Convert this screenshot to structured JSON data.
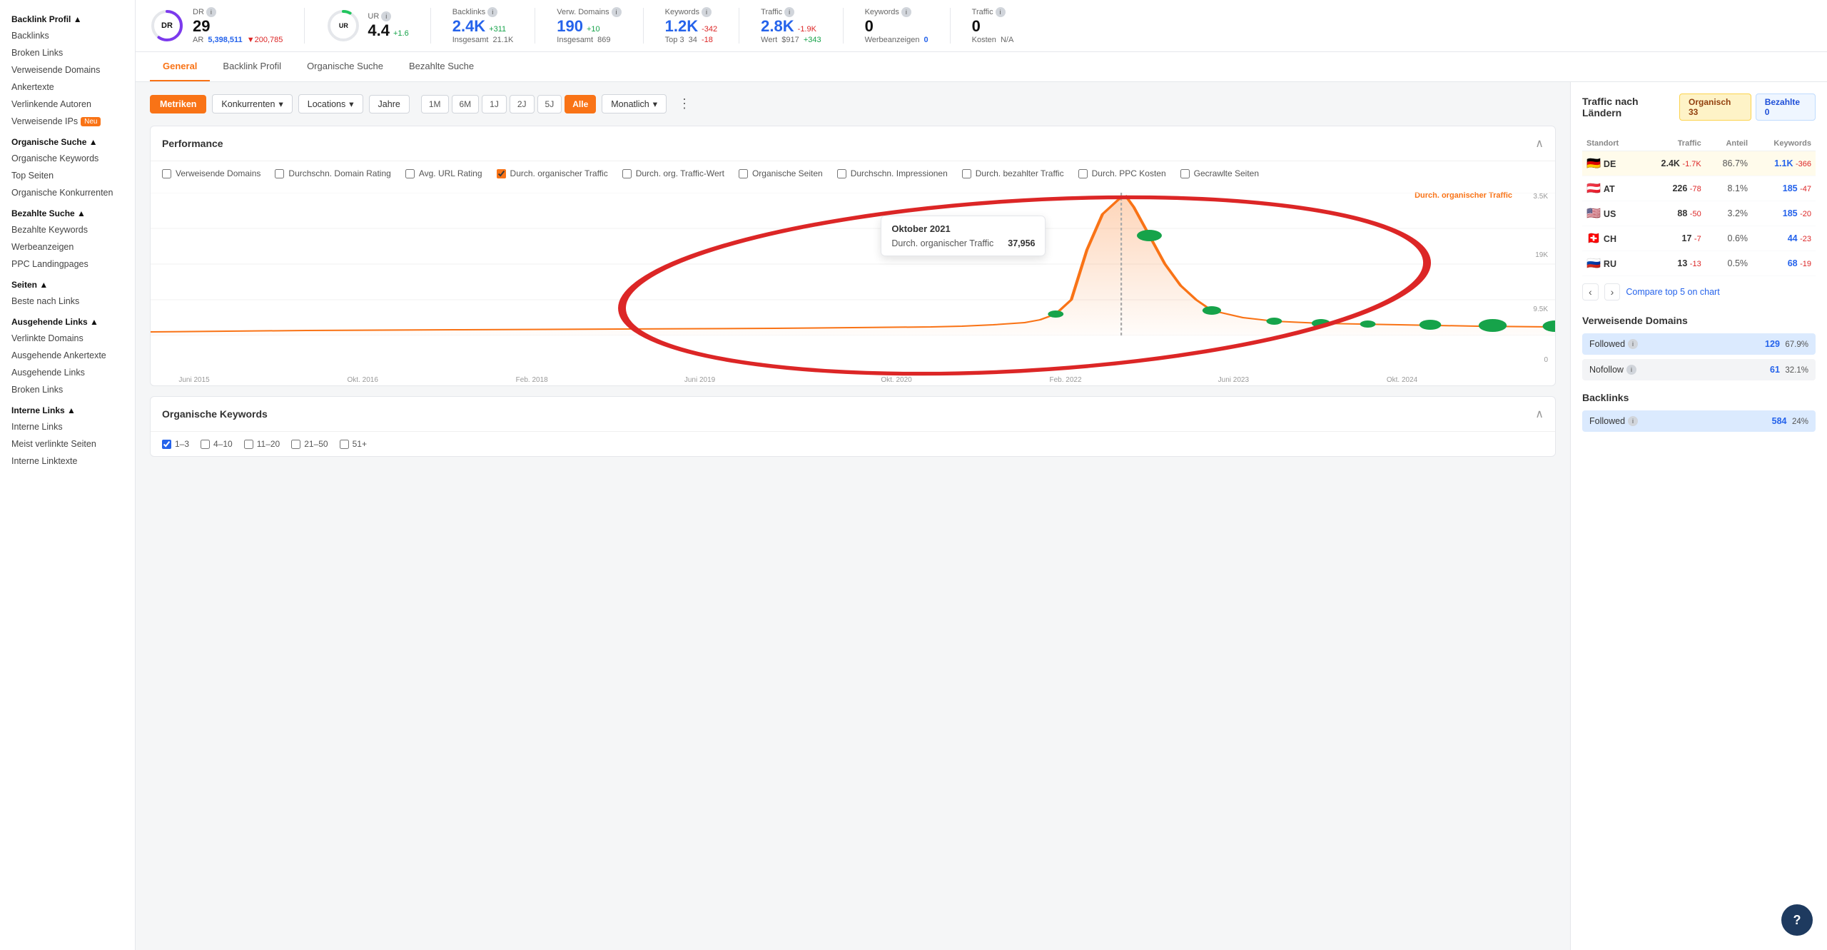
{
  "sidebar": {
    "title": "Backlink Profil",
    "sections": [
      {
        "title": "Backlink Profil ▲",
        "items": [
          "Backlinks",
          "Broken Links",
          "Verweisende Domains",
          "Ankertexte",
          "Verlinkende Autoren",
          "Verweisende IPs"
        ]
      },
      {
        "title": "Organische Suche ▲",
        "items": [
          "Organische Keywords",
          "Top Seiten",
          "Organische Konkurrenten"
        ]
      },
      {
        "title": "Bezahlte Suche ▲",
        "items": [
          "Bezahlte Keywords",
          "Werbeanzeigen",
          "PPC Landingpages"
        ]
      },
      {
        "title": "Seiten ▲",
        "items": [
          "Beste nach Links"
        ]
      },
      {
        "title": "Ausgehende Links ▲",
        "items": [
          "Verlinkte Domains",
          "Ausgehende Ankertexte",
          "Ausgehende Links",
          "Broken Links"
        ]
      },
      {
        "title": "Interne Links ▲",
        "items": [
          "Interne Links",
          "Meist verlinkte Seiten",
          "Interne Linktexte"
        ]
      }
    ],
    "badge_new": "Neu"
  },
  "metrics": {
    "dr": {
      "label": "DR",
      "value": "29",
      "ar_label": "AR",
      "ar_value": "5,398,511",
      "ar_change": "▼200,785",
      "ar_change_color": "neg"
    },
    "ur": {
      "label": "UR",
      "value": "4.4",
      "change": "+1.6",
      "change_color": "pos"
    },
    "backlinks": {
      "label": "Backlinks",
      "value": "2.4K",
      "change": "+311",
      "change_color": "pos",
      "sub_label": "Insgesamt",
      "sub_value": "21.1K"
    },
    "verw_domains": {
      "label": "Verw. Domains",
      "value": "190",
      "change": "+10",
      "change_color": "pos",
      "sub_label": "Insgesamt",
      "sub_value": "869"
    },
    "keywords": {
      "label": "Keywords",
      "value": "1.2K",
      "change": "-342",
      "change_color": "neg",
      "sub_label": "Top 3",
      "sub_value": "34",
      "sub_change": "-18",
      "sub_change_color": "neg"
    },
    "traffic": {
      "label": "Traffic",
      "value": "2.8K",
      "change": "-1.9K",
      "change_color": "neg",
      "sub_label": "Wert",
      "sub_value": "$917",
      "sub_change": "+343",
      "sub_change_color": "pos"
    },
    "keywords2": {
      "label": "Keywords",
      "value": "0",
      "sub_label": "Werbeanzeigen",
      "sub_value": "0"
    },
    "traffic2": {
      "label": "Traffic",
      "value": "0",
      "sub_label": "Kosten",
      "sub_value": "N/A"
    }
  },
  "tabs": [
    "General",
    "Backlink Profil",
    "Organische Suche",
    "Bezahlte Suche"
  ],
  "active_tab": "General",
  "toolbar": {
    "metriken_label": "Metriken",
    "konkurrenten_label": "Konkurrenten",
    "locations_label": "Locations",
    "jahre_label": "Jahre",
    "time_buttons": [
      "1M",
      "6M",
      "1J",
      "2J",
      "5J",
      "Alle"
    ],
    "active_time": "Alle",
    "monatlich_label": "Monatlich"
  },
  "performance": {
    "title": "Performance",
    "checkboxes": [
      {
        "label": "Verweisende Domains",
        "checked": false
      },
      {
        "label": "Durchschn. Domain Rating",
        "checked": false
      },
      {
        "label": "Avg. URL Rating",
        "checked": false
      },
      {
        "label": "Durch. organischer Traffic",
        "checked": true
      },
      {
        "label": "Durch. org. Traffic-Wert",
        "checked": false
      },
      {
        "label": "Organische Seiten",
        "checked": false
      },
      {
        "label": "Durchschn. Impressionen",
        "checked": false
      },
      {
        "label": "Durch. bezahlter Traffic",
        "checked": false
      },
      {
        "label": "Durch. PPC Kosten",
        "checked": false
      },
      {
        "label": "Gecrawlte Seiten",
        "checked": false
      }
    ],
    "chart_line_label": "Durch. organischer Traffic",
    "tooltip": {
      "date": "Oktober 2021",
      "label": "Durch. organischer Traffic",
      "value": "37,956"
    },
    "y_axis": [
      "3.5K",
      "19K",
      "9.5K",
      "0"
    ],
    "x_axis": [
      "Juni 2015",
      "Okt. 2016",
      "Feb. 2018",
      "Juni 2019",
      "Okt. 2020",
      "Feb. 2022",
      "Juni 2023",
      "Okt. 2024"
    ]
  },
  "organic_keywords": {
    "title": "Organische Keywords",
    "checkboxes": [
      {
        "label": "1–3",
        "checked": true
      },
      {
        "label": "4–10",
        "checked": false
      },
      {
        "label": "11–20",
        "checked": false
      },
      {
        "label": "21–50",
        "checked": false
      },
      {
        "label": "51+",
        "checked": false
      }
    ]
  },
  "right_panel": {
    "traffic_title": "Traffic nach Ländern",
    "organic_tab": "Organisch 33",
    "bezahlte_tab": "Bezahlte 0",
    "table": {
      "headers": [
        "Standort",
        "Traffic",
        "Anteil",
        "Keywords"
      ],
      "rows": [
        {
          "flag": "🇩🇪",
          "code": "DE",
          "traffic": "2.4K",
          "change": "-1.7K",
          "change_color": "neg",
          "pct": "86.7%",
          "kw": "1.1K",
          "kw_change": "-366",
          "kw_color": "neg",
          "highlighted": true
        },
        {
          "flag": "🇦🇹",
          "code": "AT",
          "traffic": "226",
          "change": "-78",
          "change_color": "neg",
          "pct": "8.1%",
          "kw": "185",
          "kw_change": "-47",
          "kw_color": "neg",
          "highlighted": false
        },
        {
          "flag": "🇺🇸",
          "code": "US",
          "traffic": "88",
          "change": "-50",
          "change_color": "neg",
          "pct": "3.2%",
          "kw": "185",
          "kw_change": "-20",
          "kw_color": "neg",
          "highlighted": false
        },
        {
          "flag": "🇨🇭",
          "code": "CH",
          "traffic": "17",
          "change": "-7",
          "change_color": "neg",
          "pct": "0.6%",
          "kw": "44",
          "kw_change": "-23",
          "kw_color": "neg",
          "highlighted": false
        },
        {
          "flag": "🇷🇺",
          "code": "RU",
          "traffic": "13",
          "change": "-13",
          "change_color": "neg",
          "pct": "0.5%",
          "kw": "68",
          "kw_change": "-19",
          "kw_color": "neg",
          "highlighted": false
        }
      ]
    },
    "compare_label": "Compare top 5 on chart",
    "verweisende_domains": {
      "title": "Verweisende Domains",
      "rows": [
        {
          "label": "Followed",
          "info": true,
          "value": "129",
          "pct": "67.9%",
          "bg": "blue-bg"
        },
        {
          "label": "Nofollow",
          "info": true,
          "value": "61",
          "pct": "32.1%",
          "bg": "gray-bg"
        }
      ]
    },
    "backlinks": {
      "title": "Backlinks",
      "rows": [
        {
          "label": "Followed",
          "info": true,
          "value": "584",
          "pct": "24%",
          "bg": "blue-bg"
        }
      ]
    }
  },
  "help_button": "?"
}
